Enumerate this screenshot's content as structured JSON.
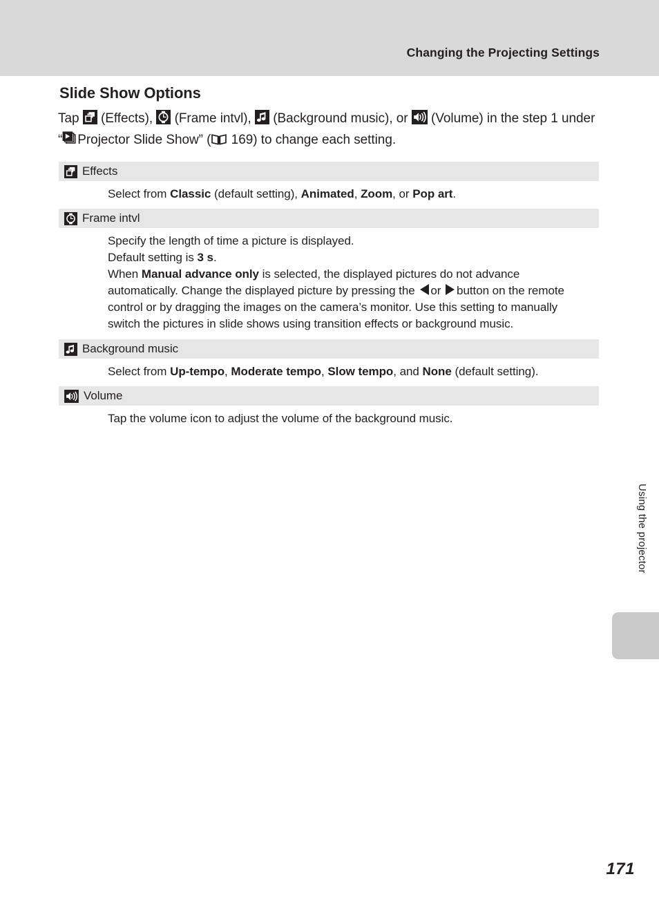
{
  "header": {
    "running_title": "Changing the Projecting Settings"
  },
  "section": {
    "title": "Slide Show Options",
    "intro_part1": "Tap",
    "intro_part2": "(Effects),",
    "intro_part3": "(Frame intvl),",
    "intro_part4": "(Background music), or",
    "intro_part5": "(Volume) in the step 1 under “",
    "intro_part6": "Projector Slide Show” (",
    "intro_page_ref": "169",
    "intro_part7": ") to change each setting."
  },
  "options": [
    {
      "icon": "effects-icon",
      "label": "Effects",
      "body_segments": [
        {
          "text": "Select from ",
          "bold": false
        },
        {
          "text": "Classic",
          "bold": true
        },
        {
          "text": " (default setting), ",
          "bold": false
        },
        {
          "text": "Animated",
          "bold": true
        },
        {
          "text": ", ",
          "bold": false
        },
        {
          "text": "Zoom",
          "bold": true
        },
        {
          "text": ", or ",
          "bold": false
        },
        {
          "text": "Pop art",
          "bold": true
        },
        {
          "text": ".",
          "bold": false
        }
      ]
    },
    {
      "icon": "clock-icon",
      "label": "Frame intvl",
      "body_segments": [
        {
          "text": "Specify the length of time a picture is displayed.",
          "bold": false
        },
        {
          "text": "\n",
          "bold": false
        },
        {
          "text": "Default setting is ",
          "bold": false
        },
        {
          "text": "3 s",
          "bold": true
        },
        {
          "text": ".",
          "bold": false
        },
        {
          "text": "\n",
          "bold": false
        },
        {
          "text": "When ",
          "bold": false
        },
        {
          "text": "Manual advance only",
          "bold": true
        },
        {
          "text": " is selected, the displayed pictures do not advance automatically. Change the displayed picture by pressing the ",
          "bold": false
        },
        {
          "text": "◀",
          "bold": false
        },
        {
          "text": " or ",
          "bold": false
        },
        {
          "text": "▶",
          "bold": false
        },
        {
          "text": " button on the remote control or by dragging the images on the camera’s monitor. Use this setting to manually switch the pictures in slide shows using transition effects or background music.",
          "bold": false
        }
      ]
    },
    {
      "icon": "music-note-icon",
      "label": "Background music",
      "body_segments": [
        {
          "text": "Select from ",
          "bold": false
        },
        {
          "text": "Up-tempo",
          "bold": true
        },
        {
          "text": ", ",
          "bold": false
        },
        {
          "text": "Moderate tempo",
          "bold": true
        },
        {
          "text": ", ",
          "bold": false
        },
        {
          "text": "Slow tempo",
          "bold": true
        },
        {
          "text": ", and ",
          "bold": false
        },
        {
          "text": "None",
          "bold": true
        },
        {
          "text": " (default setting).",
          "bold": false
        }
      ]
    },
    {
      "icon": "volume-icon",
      "label": "Volume",
      "body_segments": [
        {
          "text": "Tap the volume icon to adjust the volume of the background music.",
          "bold": false
        }
      ]
    }
  ],
  "side_tab": {
    "chapter_label": "Using the projector"
  },
  "footer": {
    "page_number": "171"
  },
  "colors": {
    "header_band": "#d9d9d9",
    "row_band": "#e6e6e6",
    "side_tab": "#c9c9c9",
    "text": "#231f20"
  }
}
